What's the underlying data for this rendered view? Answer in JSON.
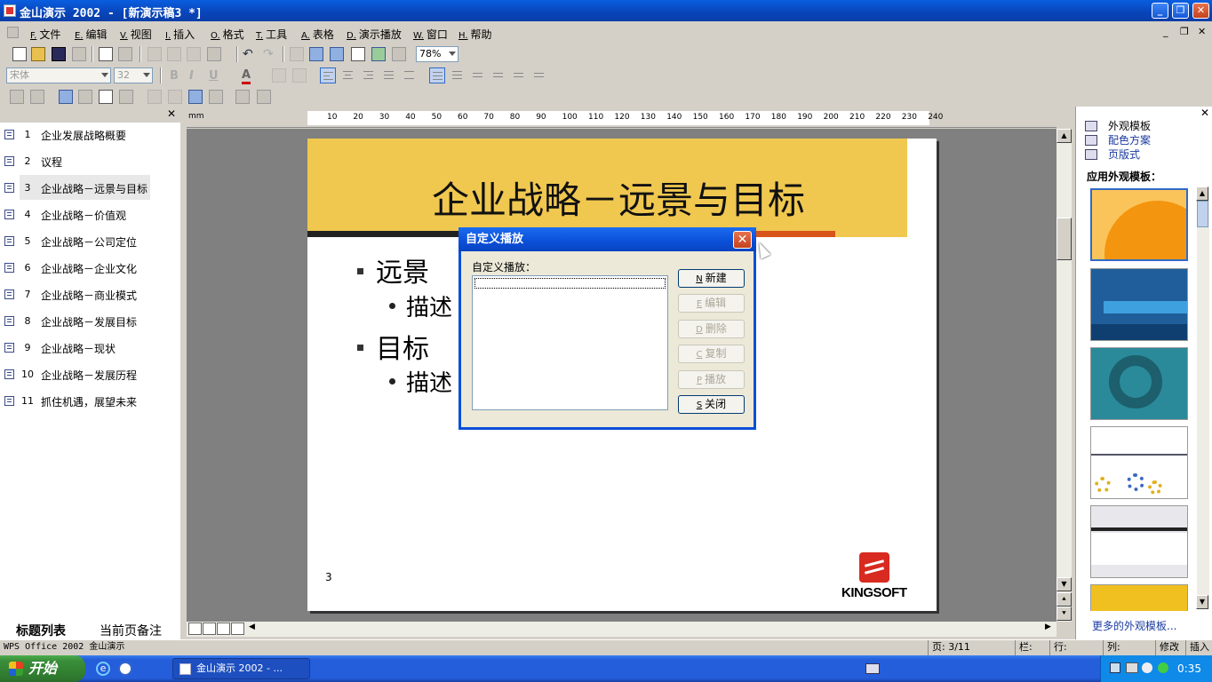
{
  "window": {
    "title": "金山演示 2002 - [新演示稿3 *]",
    "min_label": "_",
    "max_label": "❐",
    "close_label": "✕"
  },
  "menu": [
    {
      "acc": "F.",
      "label": "文件"
    },
    {
      "acc": "E.",
      "label": "编辑"
    },
    {
      "acc": "V.",
      "label": "视图"
    },
    {
      "acc": "I.",
      "label": "插入"
    },
    {
      "acc": "O.",
      "label": "格式"
    },
    {
      "acc": "T.",
      "label": "工具"
    },
    {
      "acc": "A.",
      "label": "表格"
    },
    {
      "acc": "D.",
      "label": "演示播放"
    },
    {
      "acc": "W.",
      "label": "窗口"
    },
    {
      "acc": "H.",
      "label": "帮助"
    }
  ],
  "toolbar": {
    "zoom": "78%",
    "font_name": "宋体",
    "font_size": "32",
    "bold": "B",
    "italic": "I",
    "underline": "U",
    "font_color": "A"
  },
  "ruler": {
    "unit": "mm",
    "ticks": [
      "10",
      "20",
      "30",
      "40",
      "50",
      "60",
      "70",
      "80",
      "90",
      "100",
      "110",
      "120",
      "130",
      "140",
      "150",
      "160",
      "170",
      "180",
      "190",
      "200",
      "210",
      "220",
      "230",
      "240"
    ]
  },
  "left_pane": {
    "slides": [
      {
        "num": "1",
        "title": "企业发展战略概要"
      },
      {
        "num": "2",
        "title": "议程"
      },
      {
        "num": "3",
        "title": "企业战略－远景与目标"
      },
      {
        "num": "4",
        "title": "企业战略－价值观"
      },
      {
        "num": "5",
        "title": "企业战略－公司定位"
      },
      {
        "num": "6",
        "title": "企业战略－企业文化"
      },
      {
        "num": "7",
        "title": "企业战略－商业模式"
      },
      {
        "num": "8",
        "title": "企业战略－发展目标"
      },
      {
        "num": "9",
        "title": "企业战略－现状"
      },
      {
        "num": "10",
        "title": "企业战略－发展历程"
      },
      {
        "num": "11",
        "title": "抓住机遇，展望未来"
      }
    ],
    "tab_outline": "标题列表",
    "tab_notes": "当前页备注"
  },
  "slide": {
    "title": "企业战略－远景与目标",
    "bullets": [
      {
        "level": 1,
        "text": "远景"
      },
      {
        "level": 2,
        "text": "描述"
      },
      {
        "level": 1,
        "text": "目标"
      },
      {
        "level": 2,
        "text": "描述"
      }
    ],
    "page_number": "3",
    "logo_text": "KINGSOFT"
  },
  "dialog": {
    "title": "自定义播放",
    "list_label": "自定义播放：",
    "buttons": [
      {
        "acc": "N",
        "label": "新建",
        "enabled": true
      },
      {
        "acc": "E",
        "label": "编辑",
        "enabled": false
      },
      {
        "acc": "D",
        "label": "删除",
        "enabled": false
      },
      {
        "acc": "C",
        "label": "复制",
        "enabled": false
      },
      {
        "acc": "P",
        "label": "播放",
        "enabled": false
      },
      {
        "acc": "S",
        "label": "关闭",
        "enabled": true
      }
    ]
  },
  "right_pane": {
    "links": [
      "外观模板",
      "配色方案",
      "页版式"
    ],
    "heading": "应用外观模板：",
    "more_link": "更多的外观模板..."
  },
  "status": {
    "app": "WPS Office 2002 金山演示",
    "page": "页: 3/11",
    "col": "栏:",
    "row": "行:",
    "column": "列:",
    "modify": "修改",
    "insert": "插入"
  },
  "taskbar": {
    "start": "开始",
    "app_button": "金山演示 2002 - ...",
    "clock": "0:35"
  },
  "colors": {
    "slide_header": "#f0c850",
    "accent_orange": "#d9541a",
    "xp_blue": "#0a4fd8"
  }
}
